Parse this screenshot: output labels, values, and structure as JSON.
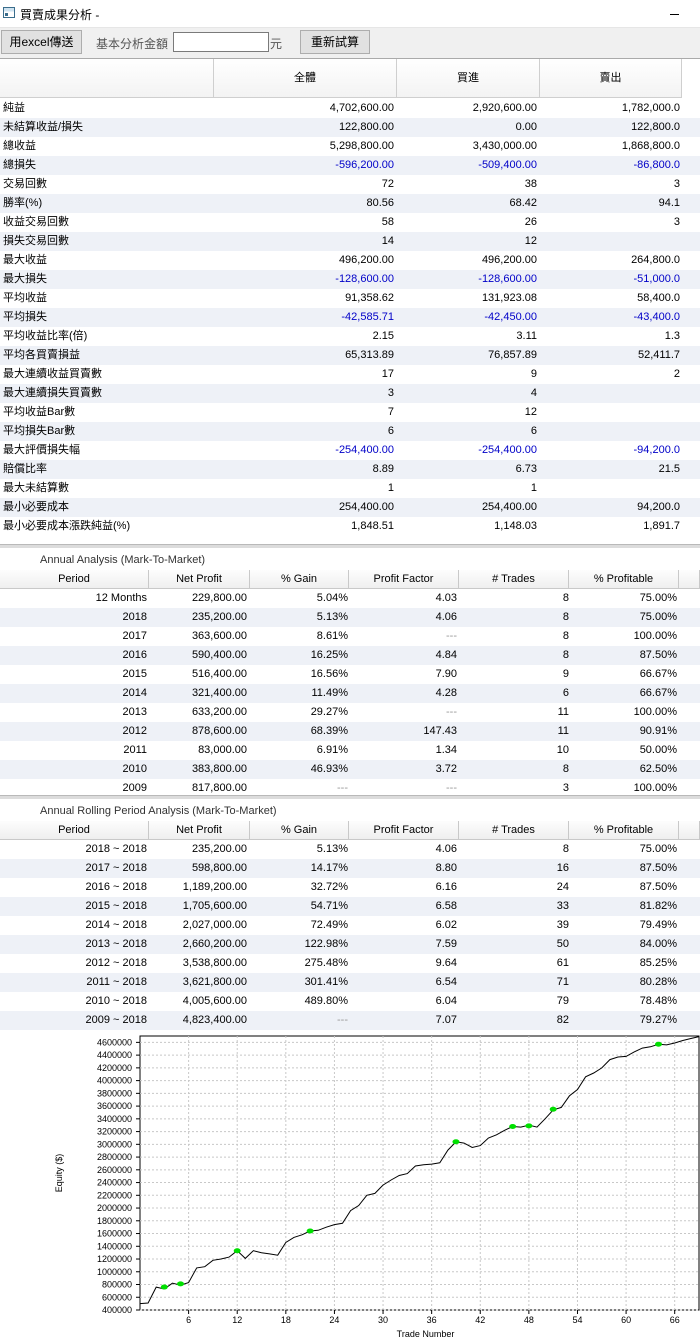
{
  "window": {
    "title": "買賣成果分析 -"
  },
  "toolbar": {
    "excel_label": "用excel傳送",
    "amount_label": "基本分析金額",
    "amount_value": "",
    "unit_label": "元",
    "recalc_label": "重新試算"
  },
  "summary": {
    "headers": [
      "全體",
      "買進",
      "賣出"
    ],
    "rows": [
      {
        "label": "純益",
        "all": "4,702,600.00",
        "buy": "2,920,600.00",
        "sell": "1,782,000.0"
      },
      {
        "label": "未結算收益/損失",
        "all": "122,800.00",
        "buy": "0.00",
        "sell": "122,800.0"
      },
      {
        "label": "總收益",
        "all": "5,298,800.00",
        "buy": "3,430,000.00",
        "sell": "1,868,800.0"
      },
      {
        "label": "總損失",
        "all": "-596,200.00",
        "buy": "-509,400.00",
        "sell": "-86,800.0"
      },
      {
        "label": "交易回數",
        "all": "72",
        "buy": "38",
        "sell": "3"
      },
      {
        "label": "勝率(%)",
        "all": "80.56",
        "buy": "68.42",
        "sell": "94.1"
      },
      {
        "label": "收益交易回數",
        "all": "58",
        "buy": "26",
        "sell": "3"
      },
      {
        "label": "損失交易回數",
        "all": "14",
        "buy": "12",
        "sell": ""
      },
      {
        "label": "最大收益",
        "all": "496,200.00",
        "buy": "496,200.00",
        "sell": "264,800.0"
      },
      {
        "label": "最大損失",
        "all": "-128,600.00",
        "buy": "-128,600.00",
        "sell": "-51,000.0"
      },
      {
        "label": "平均收益",
        "all": "91,358.62",
        "buy": "131,923.08",
        "sell": "58,400.0"
      },
      {
        "label": "平均損失",
        "all": "-42,585.71",
        "buy": "-42,450.00",
        "sell": "-43,400.0"
      },
      {
        "label": "平均收益比率(倍)",
        "all": "2.15",
        "buy": "3.11",
        "sell": "1.3"
      },
      {
        "label": "平均各買賣損益",
        "all": "65,313.89",
        "buy": "76,857.89",
        "sell": "52,411.7"
      },
      {
        "label": "最大連續收益買賣數",
        "all": "17",
        "buy": "9",
        "sell": "2"
      },
      {
        "label": "最大連續損失買賣數",
        "all": "3",
        "buy": "4",
        "sell": ""
      },
      {
        "label": "平均收益Bar數",
        "all": "7",
        "buy": "12",
        "sell": ""
      },
      {
        "label": "平均損失Bar數",
        "all": "6",
        "buy": "6",
        "sell": ""
      },
      {
        "label": "最大評價損失幅",
        "all": "-254,400.00",
        "buy": "-254,400.00",
        "sell": "-94,200.0"
      },
      {
        "label": "賠償比率",
        "all": "8.89",
        "buy": "6.73",
        "sell": "21.5"
      },
      {
        "label": "最大未結算數",
        "all": "1",
        "buy": "1",
        "sell": ""
      },
      {
        "label": "最小必要成本",
        "all": "254,400.00",
        "buy": "254,400.00",
        "sell": "94,200.0"
      },
      {
        "label": "最小必要成本漲跌純益(%)",
        "all": "1,848.51",
        "buy": "1,148.03",
        "sell": "1,891.7"
      }
    ]
  },
  "annual": {
    "title": "Annual Analysis (Mark-To-Market)",
    "headers": [
      "Period",
      "Net Profit",
      "% Gain",
      "Profit Factor",
      "# Trades",
      "% Profitable"
    ],
    "rows": [
      {
        "period": "12 Months",
        "np": "229,800.00",
        "gain": "5.04%",
        "pf": "4.03",
        "tr": "8",
        "pp": "75.00%"
      },
      {
        "period": "2018",
        "np": "235,200.00",
        "gain": "5.13%",
        "pf": "4.06",
        "tr": "8",
        "pp": "75.00%"
      },
      {
        "period": "2017",
        "np": "363,600.00",
        "gain": "8.61%",
        "pf": "---",
        "tr": "8",
        "pp": "100.00%"
      },
      {
        "period": "2016",
        "np": "590,400.00",
        "gain": "16.25%",
        "pf": "4.84",
        "tr": "8",
        "pp": "87.50%"
      },
      {
        "period": "2015",
        "np": "516,400.00",
        "gain": "16.56%",
        "pf": "7.90",
        "tr": "9",
        "pp": "66.67%"
      },
      {
        "period": "2014",
        "np": "321,400.00",
        "gain": "11.49%",
        "pf": "4.28",
        "tr": "6",
        "pp": "66.67%"
      },
      {
        "period": "2013",
        "np": "633,200.00",
        "gain": "29.27%",
        "pf": "---",
        "tr": "11",
        "pp": "100.00%"
      },
      {
        "period": "2012",
        "np": "878,600.00",
        "gain": "68.39%",
        "pf": "147.43",
        "tr": "11",
        "pp": "90.91%"
      },
      {
        "period": "2011",
        "np": "83,000.00",
        "gain": "6.91%",
        "pf": "1.34",
        "tr": "10",
        "pp": "50.00%"
      },
      {
        "period": "2010",
        "np": "383,800.00",
        "gain": "46.93%",
        "pf": "3.72",
        "tr": "8",
        "pp": "62.50%"
      },
      {
        "period": "2009",
        "np": "817,800.00",
        "gain": "---",
        "pf": "---",
        "tr": "3",
        "pp": "100.00%"
      }
    ]
  },
  "rolling": {
    "title": "Annual Rolling Period Analysis (Mark-To-Market)",
    "headers": [
      "Period",
      "Net Profit",
      "% Gain",
      "Profit Factor",
      "# Trades",
      "% Profitable"
    ],
    "rows": [
      {
        "period": "2018 ~ 2018",
        "np": "235,200.00",
        "gain": "5.13%",
        "pf": "4.06",
        "tr": "8",
        "pp": "75.00%"
      },
      {
        "period": "2017 ~ 2018",
        "np": "598,800.00",
        "gain": "14.17%",
        "pf": "8.80",
        "tr": "16",
        "pp": "87.50%"
      },
      {
        "period": "2016 ~ 2018",
        "np": "1,189,200.00",
        "gain": "32.72%",
        "pf": "6.16",
        "tr": "24",
        "pp": "87.50%"
      },
      {
        "period": "2015 ~ 2018",
        "np": "1,705,600.00",
        "gain": "54.71%",
        "pf": "6.58",
        "tr": "33",
        "pp": "81.82%"
      },
      {
        "period": "2014 ~ 2018",
        "np": "2,027,000.00",
        "gain": "72.49%",
        "pf": "6.02",
        "tr": "39",
        "pp": "79.49%"
      },
      {
        "period": "2013 ~ 2018",
        "np": "2,660,200.00",
        "gain": "122.98%",
        "pf": "7.59",
        "tr": "50",
        "pp": "84.00%"
      },
      {
        "period": "2012 ~ 2018",
        "np": "3,538,800.00",
        "gain": "275.48%",
        "pf": "9.64",
        "tr": "61",
        "pp": "85.25%"
      },
      {
        "period": "2011 ~ 2018",
        "np": "3,621,800.00",
        "gain": "301.41%",
        "pf": "6.54",
        "tr": "71",
        "pp": "80.28%"
      },
      {
        "period": "2010 ~ 2018",
        "np": "4,005,600.00",
        "gain": "489.80%",
        "pf": "6.04",
        "tr": "79",
        "pp": "78.48%"
      },
      {
        "period": "2009 ~ 2018",
        "np": "4,823,400.00",
        "gain": "---",
        "pf": "7.07",
        "tr": "82",
        "pp": "79.27%"
      }
    ]
  },
  "chart_data": {
    "type": "line",
    "xlabel": "Trade Number",
    "ylabel": "Equity ($)",
    "xlim": [
      0,
      69
    ],
    "ylim": [
      400000,
      4700000
    ],
    "x_ticks": [
      6,
      12,
      18,
      24,
      30,
      36,
      42,
      48,
      54,
      60,
      66
    ],
    "y_ticks": [
      400000,
      600000,
      800000,
      1000000,
      1200000,
      1400000,
      1600000,
      1800000,
      2000000,
      2200000,
      2400000,
      2600000,
      2800000,
      3000000,
      3200000,
      3400000,
      3600000,
      3800000,
      4000000,
      4200000,
      4400000,
      4600000
    ],
    "grid": true,
    "line_color": "#000000",
    "marker_color": "#00e000",
    "series": [
      {
        "x": [
          0,
          1,
          2,
          3,
          4,
          5,
          6,
          7,
          8,
          9,
          10,
          11,
          12,
          13,
          14,
          15,
          16,
          17,
          18,
          19,
          20,
          21,
          22,
          23,
          24,
          25,
          26,
          27,
          28,
          29,
          30,
          31,
          32,
          33,
          34,
          35,
          36,
          37,
          38,
          39,
          40,
          41,
          42,
          43,
          44,
          45,
          46,
          47,
          48,
          49,
          50,
          51,
          52,
          53,
          54,
          55,
          56,
          57,
          58,
          59,
          60,
          61,
          62,
          63,
          64,
          65,
          66,
          67,
          68,
          69
        ],
        "y": [
          500000,
          510000,
          760000,
          730000,
          820000,
          790000,
          830000,
          1060000,
          1080000,
          1180000,
          1200000,
          1230000,
          1330000,
          1210000,
          1330000,
          1300000,
          1280000,
          1260000,
          1460000,
          1540000,
          1580000,
          1640000,
          1650000,
          1700000,
          1740000,
          1760000,
          1960000,
          2040000,
          2200000,
          2230000,
          2360000,
          2440000,
          2510000,
          2540000,
          2660000,
          2680000,
          2690000,
          2710000,
          2910000,
          3040000,
          3020000,
          2950000,
          2980000,
          3100000,
          3150000,
          3220000,
          3280000,
          3270000,
          3300000,
          3270000,
          3400000,
          3540000,
          3580000,
          3760000,
          3860000,
          4060000,
          4120000,
          4200000,
          4330000,
          4370000,
          4380000,
          4450000,
          4510000,
          4530000,
          4570000,
          4560000,
          4590000,
          4630000,
          4660000,
          4690000
        ]
      }
    ],
    "markers": [
      [
        3,
        760000
      ],
      [
        5,
        810000
      ],
      [
        12,
        1330000
      ],
      [
        21,
        1640000
      ],
      [
        39,
        3040000
      ],
      [
        46,
        3280000
      ],
      [
        48,
        3290000
      ],
      [
        51,
        3550000
      ],
      [
        64,
        4570000
      ]
    ]
  }
}
